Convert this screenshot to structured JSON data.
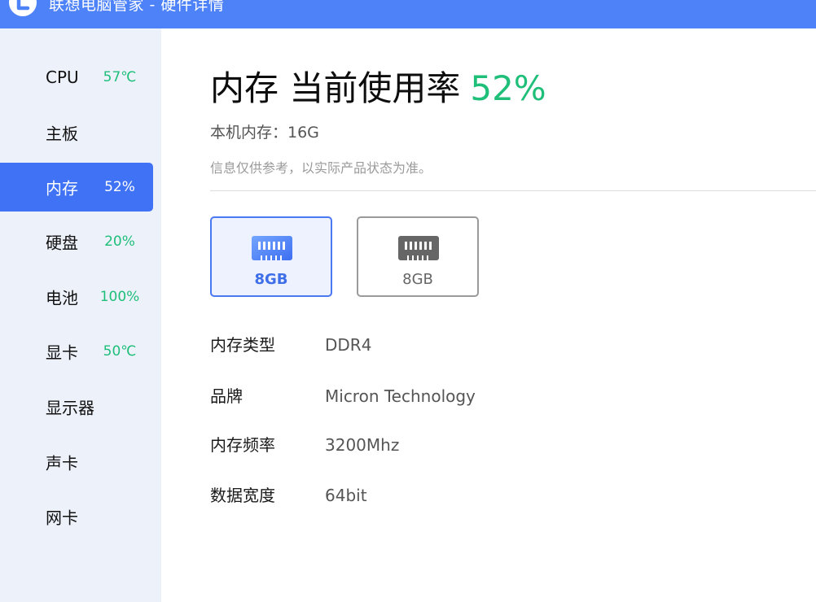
{
  "window": {
    "title": "联想电脑管家 - 硬件详情"
  },
  "sidebar": {
    "items": [
      {
        "label": "CPU",
        "value": "57℃"
      },
      {
        "label": "主板",
        "value": ""
      },
      {
        "label": "内存",
        "value": "52%"
      },
      {
        "label": "硬盘",
        "value": "20%"
      },
      {
        "label": "电池",
        "value": "100%"
      },
      {
        "label": "显卡",
        "value": "50℃"
      },
      {
        "label": "显示器",
        "value": ""
      },
      {
        "label": "声卡",
        "value": ""
      },
      {
        "label": "网卡",
        "value": ""
      }
    ],
    "active_index": 2
  },
  "main": {
    "title": "内存 当前使用率",
    "usage_percent": "52%",
    "total_memory": "本机内存：16G",
    "disclaimer": "信息仅供参考，以实际产品状态为准。",
    "modules": [
      {
        "label": "8GB",
        "selected": true
      },
      {
        "label": "8GB",
        "selected": false
      }
    ],
    "specs": [
      {
        "key": "内存类型",
        "value": "DDR4"
      },
      {
        "key": "品牌",
        "value": "Micron Technology"
      },
      {
        "key": "内存频率",
        "value": "3200Mhz"
      },
      {
        "key": "数据宽度",
        "value": "64bit"
      }
    ]
  },
  "colors": {
    "titlebar": "#4d82f8",
    "accent": "#3f72f5",
    "positive": "#1fbf7a",
    "sidebar_bg": "#edf1fa"
  },
  "icons": {
    "logo": "lenovo-logo-icon",
    "module": "ram-module-icon"
  }
}
